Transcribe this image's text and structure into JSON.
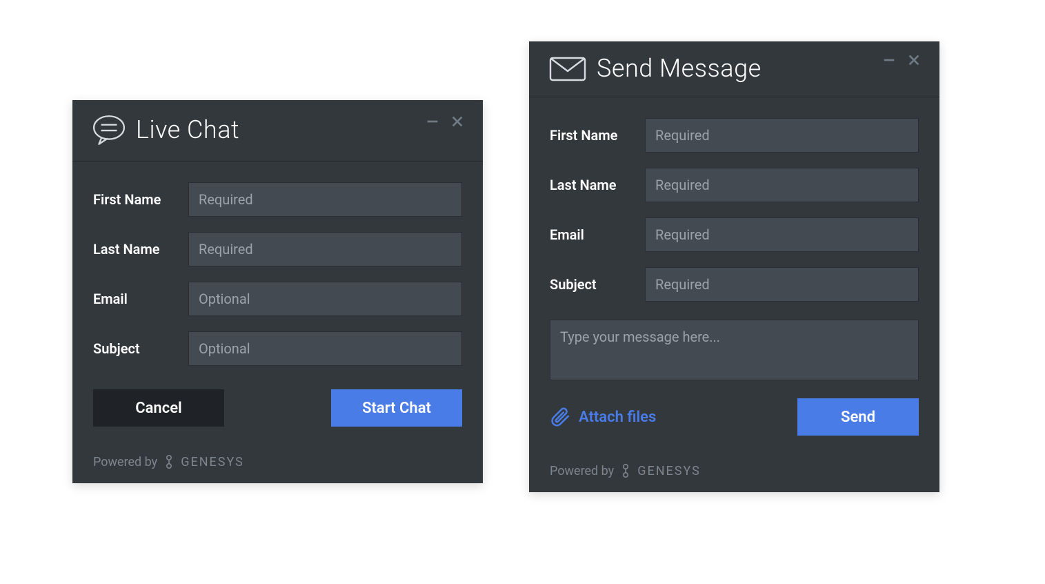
{
  "livechat": {
    "title": "Live Chat",
    "fields": {
      "first_name": {
        "label": "First Name",
        "placeholder": "Required"
      },
      "last_name": {
        "label": "Last Name",
        "placeholder": "Required"
      },
      "email": {
        "label": "Email",
        "placeholder": "Optional"
      },
      "subject": {
        "label": "Subject",
        "placeholder": "Optional"
      }
    },
    "buttons": {
      "cancel": "Cancel",
      "start": "Start Chat"
    }
  },
  "sendmsg": {
    "title": "Send Message",
    "fields": {
      "first_name": {
        "label": "First Name",
        "placeholder": "Required"
      },
      "last_name": {
        "label": "Last Name",
        "placeholder": "Required"
      },
      "email": {
        "label": "Email",
        "placeholder": "Required"
      },
      "subject": {
        "label": "Subject",
        "placeholder": "Required"
      }
    },
    "message_placeholder": "Type your message here...",
    "attach_label": "Attach files",
    "buttons": {
      "send": "Send"
    }
  },
  "footer": {
    "powered_by": "Powered by",
    "brand": "GENESYS"
  }
}
